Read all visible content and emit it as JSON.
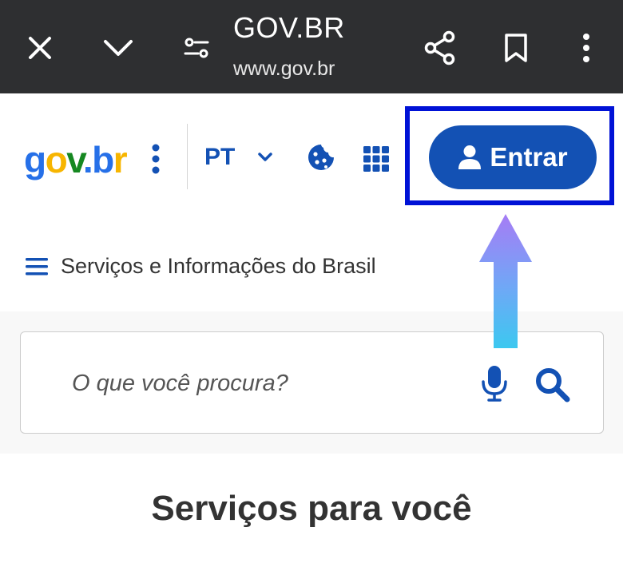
{
  "browser": {
    "title": "GOV.BR",
    "url": "www.gov.br",
    "icons": [
      "close-icon",
      "chevron-down-icon",
      "site-settings-icon",
      "share-icon",
      "bookmark-icon",
      "more-vertical-icon"
    ]
  },
  "header": {
    "logo": {
      "g": "g",
      "o": "o",
      "v": "v",
      "dot": ".",
      "b": "b",
      "r": "r"
    },
    "language": "PT",
    "login_label": "Entrar",
    "icons": [
      "more-vertical-icon",
      "chevron-down-icon",
      "cookie-icon",
      "apps-grid-icon",
      "user-icon"
    ]
  },
  "menu": {
    "label": "Serviços e Informações do Brasil"
  },
  "search": {
    "placeholder": "O que você procura?",
    "icons": [
      "microphone-icon",
      "search-icon"
    ]
  },
  "section": {
    "title": "Serviços para você"
  },
  "colors": {
    "browser_bar": "#2e2f31",
    "primary_blue": "#1351b4",
    "highlight_border": "#0012d6",
    "logo_yellow": "#f7b500",
    "logo_green": "#168821",
    "arrow_top": "#a67cf5",
    "arrow_bottom": "#3cc8f0"
  }
}
